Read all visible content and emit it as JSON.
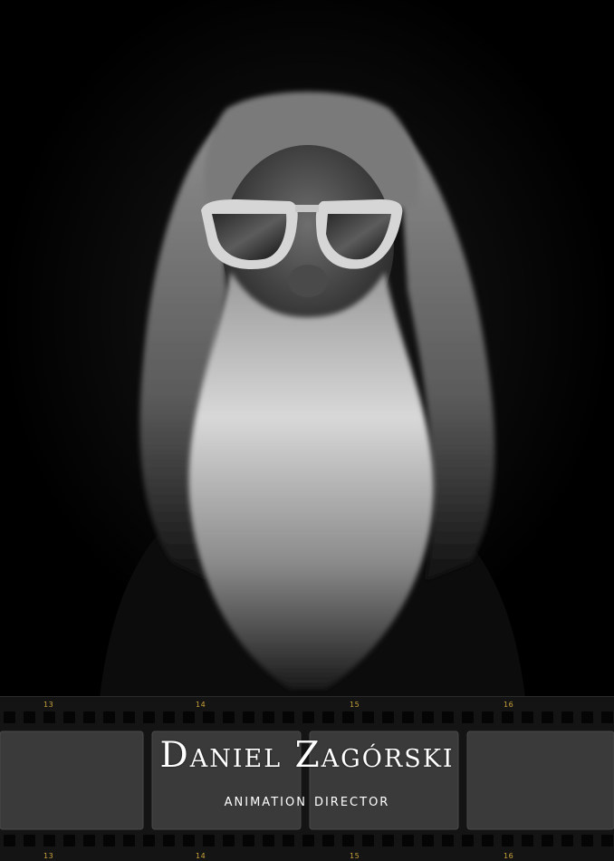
{
  "poster": {
    "name": "Daniel Zagórski",
    "role": "Animation Director"
  },
  "filmstrip": {
    "frame_numbers_top": [
      "13",
      "14",
      "15",
      "16"
    ],
    "frame_numbers_bottom": [
      "13",
      "14",
      "15",
      "16"
    ]
  },
  "colors": {
    "background": "#000000",
    "film_base": "#141414",
    "frame_fill": "#3a3a3a",
    "frame_number": "#c9a23a",
    "title_text": "#ffffff"
  }
}
